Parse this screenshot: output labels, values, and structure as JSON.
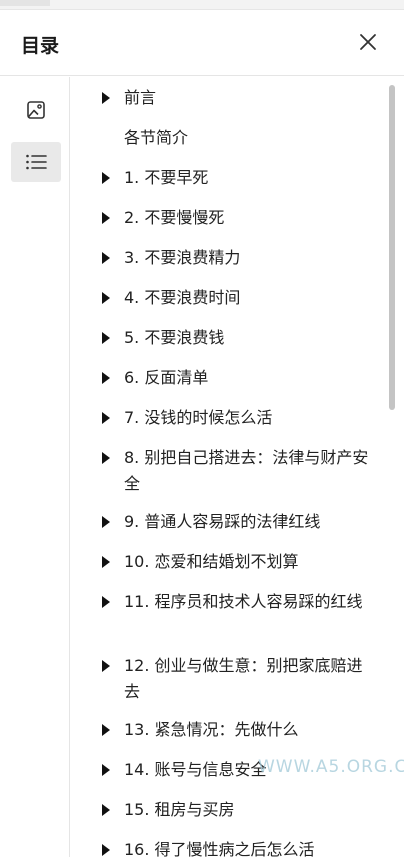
{
  "panel": {
    "title": "目录"
  },
  "toc": {
    "items": [
      {
        "label": "前言",
        "expandable": true
      },
      {
        "label": "各节简介",
        "expandable": false
      },
      {
        "label": "1. 不要早死",
        "expandable": true
      },
      {
        "label": "2. 不要慢慢死",
        "expandable": true
      },
      {
        "label": "3. 不要浪费精力",
        "expandable": true
      },
      {
        "label": "4. 不要浪费时间",
        "expandable": true
      },
      {
        "label": "5. 不要浪费钱",
        "expandable": true
      },
      {
        "label": "6. 反面清单",
        "expandable": true
      },
      {
        "label": "7. 没钱的时候怎么活",
        "expandable": true
      },
      {
        "label": "8. 别把自己搭进去：法律与财产安全",
        "expandable": true
      },
      {
        "label": "9. 普通人容易踩的法律红线",
        "expandable": true
      },
      {
        "label": "10. 恋爱和结婚划不划算",
        "expandable": true
      },
      {
        "label": "11. 程序员和技术人容易踩的红线",
        "expandable": true
      },
      {
        "label": "12. 创业与做生意：别把家底赔进去",
        "expandable": true
      },
      {
        "label": "13. 紧急情况：先做什么",
        "expandable": true
      },
      {
        "label": "14. 账号与信息安全",
        "expandable": true
      },
      {
        "label": "15. 租房与买房",
        "expandable": true
      },
      {
        "label": "16. 得了慢性病之后怎么活",
        "expandable": true
      }
    ]
  },
  "icons": {
    "close": "close-icon",
    "image": "image-icon",
    "toc": "list-icon",
    "expand": "caret-right-icon"
  },
  "watermark": "WWW.A5.ORG.CN"
}
